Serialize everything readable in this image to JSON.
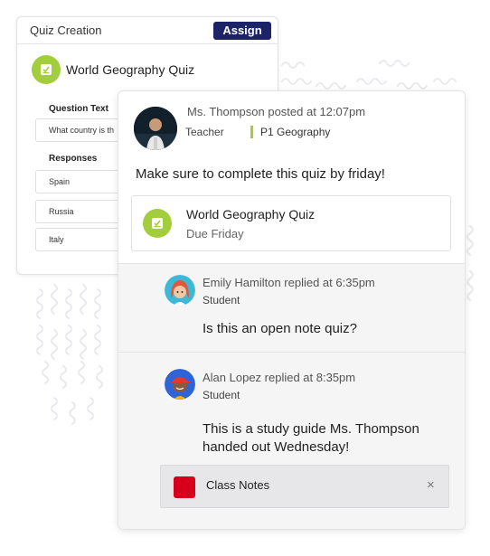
{
  "quiz_creation": {
    "title": "Quiz Creation",
    "assign_label": "Assign",
    "quiz_name": "World Geography Quiz",
    "question_text_label": "Question Text",
    "question_text_value": "What country is th",
    "responses_label": "Responses",
    "responses": [
      "Spain",
      "Russia",
      "Italy"
    ]
  },
  "post": {
    "author_line": "Ms. Thompson posted at 12:07pm",
    "role": "Teacher",
    "class_tag": "P1 Geography",
    "message": "Make sure to complete this quiz by friday!",
    "attachment": {
      "title": "World Geography Quiz",
      "due": "Due Friday"
    }
  },
  "replies": [
    {
      "author_line": "Emily Hamilton replied at 6:35pm",
      "role": "Student",
      "text": "Is this an open note quiz?"
    },
    {
      "author_line": "Alan Lopez replied at 8:35pm",
      "role": "Student",
      "text": "This is a study guide Ms. Thompson handed out Wednesday!",
      "file": {
        "name": "Class Notes",
        "close_glyph": "×",
        "color": "#d6001c"
      }
    }
  ],
  "colors": {
    "accent_green": "#a2cd3c",
    "assign_navy": "#1c2366",
    "squiggle": "#e9e9ee"
  },
  "icons": {
    "quiz": "quiz-document-icon",
    "file": "file-icon",
    "close": "close-icon"
  }
}
